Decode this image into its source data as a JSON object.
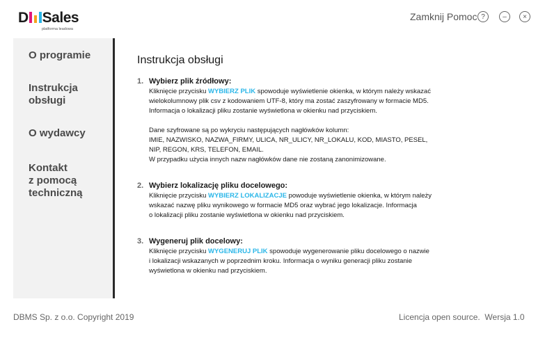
{
  "header": {
    "logo_text_before": "D",
    "logo_text_after": "Sales",
    "logo_sub": "platforma leadowa",
    "close_help_label": "Zamknij Pomoc",
    "help_glyph": "?",
    "minimize_glyph": "–",
    "close_glyph": "×",
    "logo_bar_colors": [
      "#e2187b",
      "#f4a21d",
      "#29b6e8"
    ]
  },
  "sidebar": {
    "items": [
      {
        "label": "O programie"
      },
      {
        "label": "Instrukcja\nobsługi"
      },
      {
        "label": "O wydawcy"
      },
      {
        "label": "Kontakt\nz pomocą\ntechniczną"
      }
    ]
  },
  "content": {
    "title": "Instrukcja obsługi",
    "steps": [
      {
        "num": "1.",
        "heading": "Wybierz plik źródłowy:",
        "l1a": "Kliknięcie przycisku ",
        "l1b": "WYBIERZ PLIK",
        "l1c": " spowoduje wyświetlenie okienka, w którym należy wskazać",
        "l2": "wielokolumnowy plik csv z kodowaniem UTF-8, który ma zostać zaszyfrowany w formacie MD5.",
        "l3": "Informacja o lokalizacji pliku zostanie wyświetlona w okienku nad przyciskiem.",
        "l4": "Dane szyfrowane są po wykryciu następujących nagłówków kolumn:",
        "l5": "IMIE, NAZWISKO, NAZWA_FIRMY, ULICA, NR_ULICY, NR_LOKALU, KOD, MIASTO, PESEL,",
        "l6": "NIP, REGON, KRS, TELEFON, EMAIL.",
        "l7": "W przypadku użycia innych nazw nagłówków dane nie zostaną zanonimizowane."
      },
      {
        "num": "2.",
        "heading": "Wybierz lokalizację pliku docelowego:",
        "l1a": "Kliknięcie przycisku ",
        "l1b": "WYBIERZ LOKALIZACJE",
        "l1c": " powoduje wyświetlenie okienka, w którym należy",
        "l2": "wskazać nazwę pliku wynikowego w formacie MD5 oraz wybrać jego lokalizacje. Informacja",
        "l3": "o lokalizacji pliku zostanie wyświetlona w okienku nad przyciskiem."
      },
      {
        "num": "3.",
        "heading": "Wygeneruj plik docelowy:",
        "l1a": "Kliknięcie przycisku ",
        "l1b": "WYGENERUJ PLIK",
        "l1c": " spowoduje wygenerowanie pliku docelowego o nazwie",
        "l2": "i lokalizacji wskazanych w poprzednim kroku. Informacja o wyniku generacji pliku zostanie",
        "l3": "wyświetlona w okienku nad przyciskiem."
      }
    ]
  },
  "footer": {
    "copyright": "DBMS Sp. z o.o. Copyright 2019",
    "license": "Licencja open source.",
    "version": "Wersja 1.0"
  }
}
